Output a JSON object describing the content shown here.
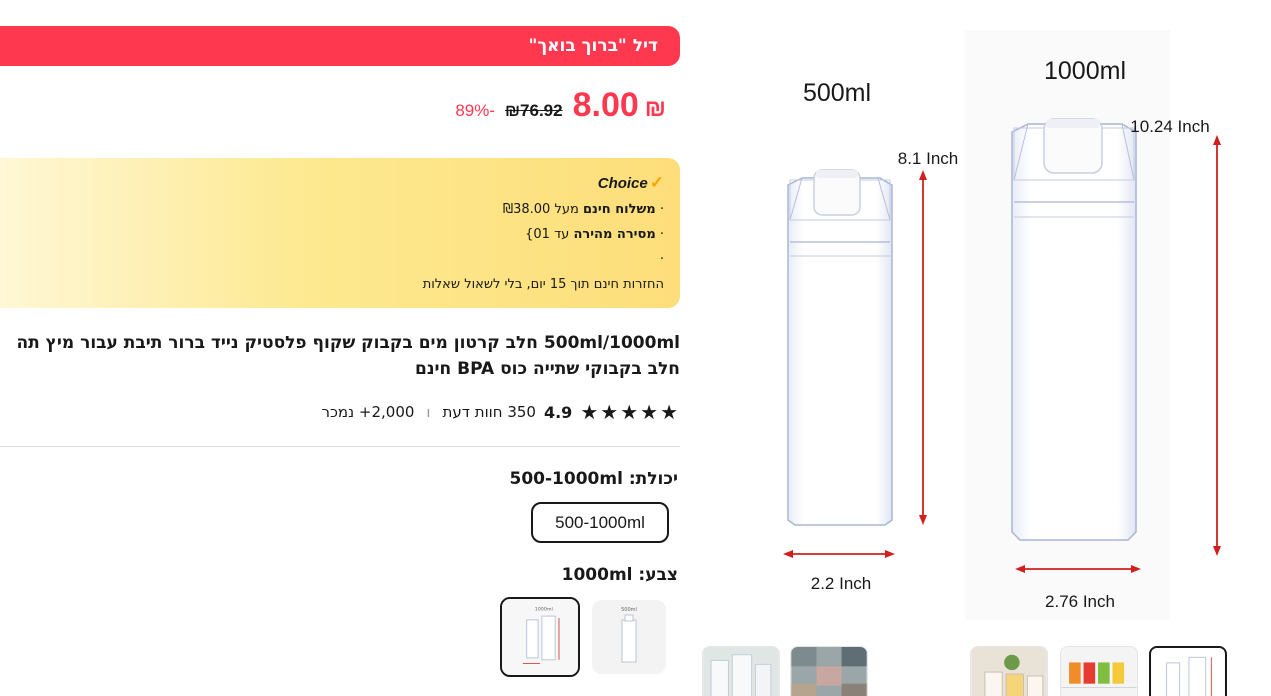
{
  "deal": {
    "label": "דיל \"ברוך בואך\""
  },
  "price": {
    "current_currency": "₪",
    "current_value": "8.00",
    "original": "₪76.92",
    "discount": "-89%"
  },
  "choice": {
    "brand": "Choice",
    "line1_prefix": "· ",
    "line1_bold": "משלוח חינם",
    "line1_rest": " מעל ₪38.00",
    "line2_prefix": "· ",
    "line2_bold": "מסירה מהירה",
    "line2_rest": " עד 01}",
    "line3": "·",
    "line4": "החזרות חינם תוך 15 יום, בלי לשאול שאלות"
  },
  "product": {
    "title": "500ml/1000ml חלב קרטון מים בקבוק שקוף פלסטיק נייד ברור תיבת עבור מיץ תה חלב בקבוקי שתייה כוס BPA חינם"
  },
  "rating": {
    "score": "4.9",
    "reviews": "350 חוות דעת",
    "separator": "ו",
    "sold": "2,000+ נמכר",
    "stars": 5
  },
  "capacity": {
    "label": "יכולת: 500-1000ml",
    "options": [
      "500-1000ml"
    ],
    "selected": "500-1000ml"
  },
  "color": {
    "label": "צבע: 1000ml",
    "swatch1_label": "1000ml",
    "swatch2_label": "500ml"
  },
  "image": {
    "small_volume": "500ml",
    "large_volume": "1000ml",
    "small_height": "8.1 Inch",
    "large_height": "10.24 Inch",
    "small_width": "2.2 Inch",
    "large_width": "2.76 Inch"
  },
  "colors": {
    "accent": "#fd384f",
    "choice_gold": "#fdde7a",
    "measure_red": "#d0201e",
    "text": "#191919"
  }
}
